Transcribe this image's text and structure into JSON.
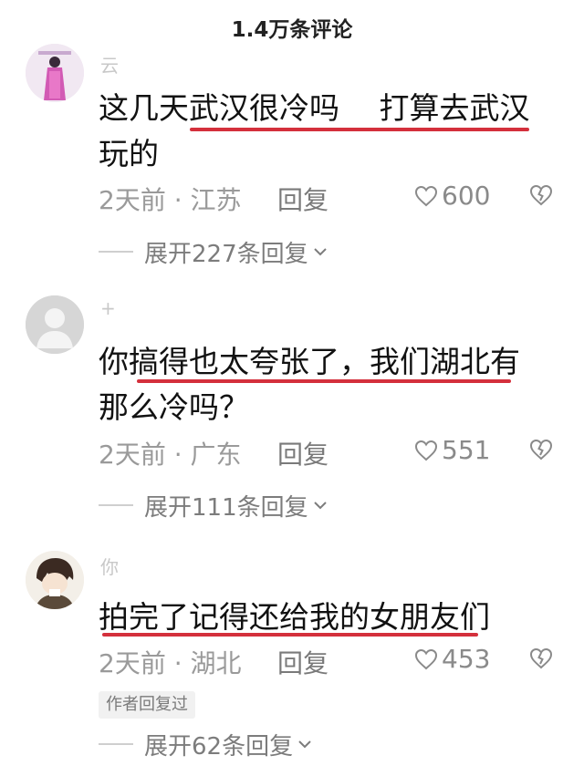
{
  "header": {
    "title": "1.4万条评论"
  },
  "comments": [
    {
      "username": "云",
      "lines": [
        "这几天武汉很冷吗　 打算去武汉",
        "玩的"
      ],
      "time_location": "2天前 · 江苏",
      "reply_label": "回复",
      "likes": "600",
      "expand_label": "展开227条回复"
    },
    {
      "username": "+",
      "lines": [
        "你搞得也太夸张了，我们湖北有",
        "那么冷吗？"
      ],
      "time_location": "2天前 · 广东",
      "reply_label": "回复",
      "likes": "551",
      "expand_label": "展开111条回复"
    },
    {
      "username": "你",
      "lines": [
        "拍完了记得还给我的女朋友们"
      ],
      "time_location": "2天前 · 湖北",
      "reply_label": "回复",
      "likes": "453",
      "author_tag": "作者回复过",
      "expand_label": "展开62条回复"
    }
  ],
  "icons": {
    "like": "heart-outline-icon",
    "dislike": "broken-heart-icon",
    "expand": "chevron-down-icon"
  },
  "colors": {
    "underline": "#d4303c",
    "meta": "#9a9a9a"
  }
}
